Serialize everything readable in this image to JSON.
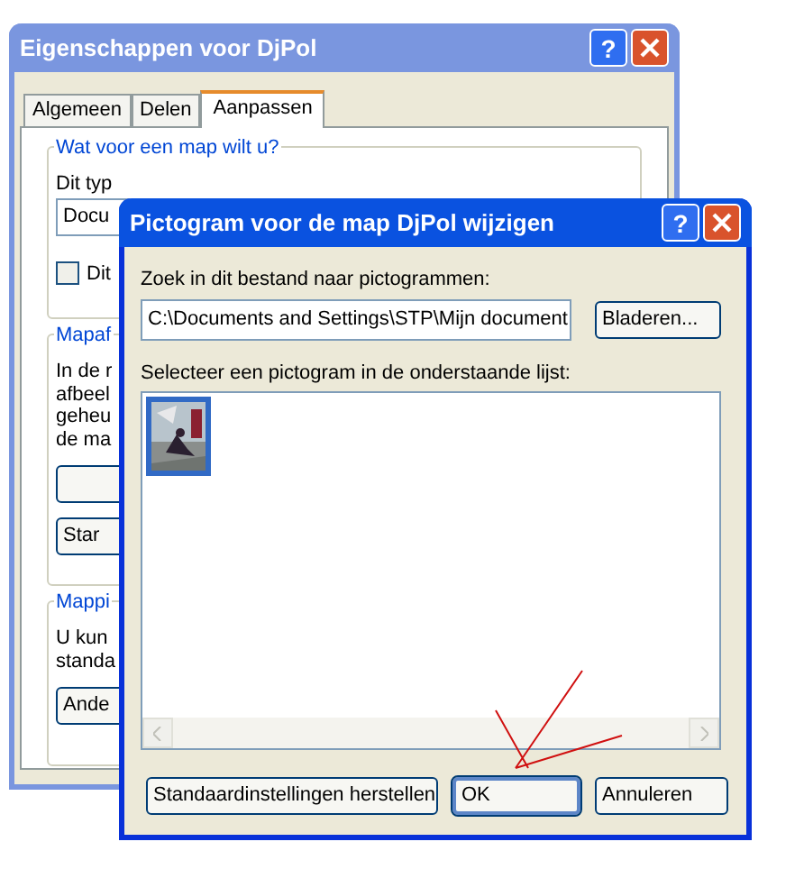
{
  "background_window": {
    "title": "Eigenschappen voor DjPol",
    "help_label": "?",
    "tabs": [
      {
        "label": "Algemeen",
        "selected": false
      },
      {
        "label": "Delen",
        "selected": false
      },
      {
        "label": "Aanpassen",
        "selected": true
      }
    ],
    "groups": [
      {
        "legend": "Wat voor een map wilt u?",
        "items": [
          {
            "kind": "text",
            "text": "Dit typ"
          },
          {
            "kind": "select",
            "value": "Docu"
          },
          {
            "kind": "checkbox",
            "label": "Dit",
            "checked": false
          }
        ]
      },
      {
        "legend": "Mapaf",
        "items": [
          {
            "kind": "text",
            "text": "In de r"
          },
          {
            "kind": "text",
            "text": "afbeel"
          },
          {
            "kind": "text",
            "text": "geheu"
          },
          {
            "kind": "text",
            "text": "de ma"
          },
          {
            "kind": "button"
          },
          {
            "kind": "button",
            "label": "Star"
          }
        ]
      },
      {
        "legend": "Mappi",
        "items": [
          {
            "kind": "text",
            "text": "U kun"
          },
          {
            "kind": "text",
            "text": "standa"
          },
          {
            "kind": "button",
            "label": "Ande"
          }
        ]
      }
    ]
  },
  "dialog": {
    "title": "Pictogram voor de map DjPol wijzigen",
    "help_label": "?",
    "file_label": "Zoek in dit bestand naar pictogrammen:",
    "file_path": "C:\\Documents and Settings\\STP\\Mijn document",
    "browse_button": "Bladeren...",
    "list_label": "Selecteer een pictogram in de onderstaande lijst:",
    "icons": [
      {
        "kind": "picture",
        "selected": true
      }
    ],
    "buttons": [
      {
        "label": "Standaardinstellingen herstellen",
        "default": false
      },
      {
        "label": "OK",
        "default": true
      },
      {
        "label": "Annuleren",
        "default": false
      }
    ]
  }
}
